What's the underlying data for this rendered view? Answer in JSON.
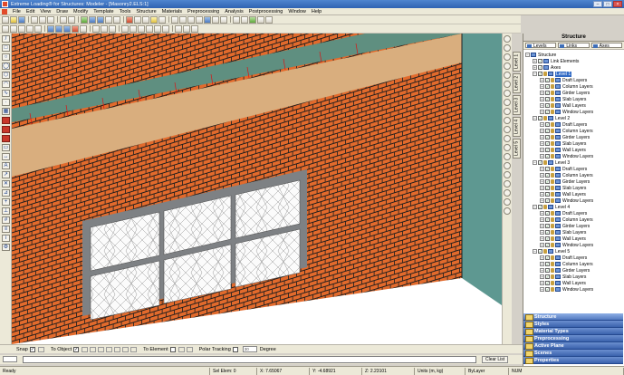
{
  "window": {
    "title": "Extreme Loading® for Structures: Modeler - [Masonry2.ELS:1]"
  },
  "menu": [
    "File",
    "Edit",
    "View",
    "Draw",
    "Modify",
    "Template",
    "Tools",
    "Structure",
    "Materials",
    "Preprocessing",
    "Analysis",
    "Postprocessing",
    "Window",
    "Help"
  ],
  "right_tabs": [
    "Level 1",
    "Level 2",
    "Level 3",
    "Level 4",
    "Level 5"
  ],
  "panel": {
    "title": "Structure",
    "tabs": [
      "Levels",
      "Links",
      "Axes"
    ],
    "tree": [
      {
        "label": "Structure",
        "depth": 0,
        "expand": "−",
        "checked": false,
        "lock": false,
        "selected": false
      },
      {
        "label": "Link Elements",
        "depth": 1,
        "expand": "+",
        "checked": true,
        "lock": false,
        "selected": false
      },
      {
        "label": "Axes",
        "depth": 1,
        "expand": "+",
        "checked": true,
        "lock": false,
        "selected": false
      },
      {
        "label": "Level 1",
        "depth": 1,
        "expand": "−",
        "checked": true,
        "lock": true,
        "selected": true
      },
      {
        "label": "Draft Layers",
        "depth": 2,
        "expand": "+",
        "checked": true,
        "lock": true,
        "selected": false
      },
      {
        "label": "Column Layers",
        "depth": 2,
        "expand": "+",
        "checked": true,
        "lock": true,
        "selected": false
      },
      {
        "label": "Girder Layers",
        "depth": 2,
        "expand": "+",
        "checked": true,
        "lock": true,
        "selected": false
      },
      {
        "label": "Slab Layers",
        "depth": 2,
        "expand": "+",
        "checked": true,
        "lock": true,
        "selected": false
      },
      {
        "label": "Wall Layers",
        "depth": 2,
        "expand": "+",
        "checked": true,
        "lock": true,
        "selected": false
      },
      {
        "label": "Window Layers",
        "depth": 2,
        "expand": "+",
        "checked": true,
        "lock": true,
        "selected": false
      },
      {
        "label": "Level 2",
        "depth": 1,
        "expand": "−",
        "checked": true,
        "lock": true,
        "selected": false
      },
      {
        "label": "Draft Layers",
        "depth": 2,
        "expand": "+",
        "checked": true,
        "lock": true,
        "selected": false
      },
      {
        "label": "Column Layers",
        "depth": 2,
        "expand": "+",
        "checked": true,
        "lock": true,
        "selected": false
      },
      {
        "label": "Girder Layers",
        "depth": 2,
        "expand": "+",
        "checked": true,
        "lock": true,
        "selected": false
      },
      {
        "label": "Slab Layers",
        "depth": 2,
        "expand": "+",
        "checked": true,
        "lock": true,
        "selected": false
      },
      {
        "label": "Wall Layers",
        "depth": 2,
        "expand": "+",
        "checked": true,
        "lock": true,
        "selected": false
      },
      {
        "label": "Window Layers",
        "depth": 2,
        "expand": "+",
        "checked": true,
        "lock": true,
        "selected": false
      },
      {
        "label": "Level 3",
        "depth": 1,
        "expand": "−",
        "checked": true,
        "lock": true,
        "selected": false
      },
      {
        "label": "Draft Layers",
        "depth": 2,
        "expand": "+",
        "checked": true,
        "lock": true,
        "selected": false
      },
      {
        "label": "Column Layers",
        "depth": 2,
        "expand": "+",
        "checked": true,
        "lock": true,
        "selected": false
      },
      {
        "label": "Girder Layers",
        "depth": 2,
        "expand": "+",
        "checked": true,
        "lock": true,
        "selected": false
      },
      {
        "label": "Slab Layers",
        "depth": 2,
        "expand": "+",
        "checked": true,
        "lock": true,
        "selected": false
      },
      {
        "label": "Wall Layers",
        "depth": 2,
        "expand": "+",
        "checked": true,
        "lock": true,
        "selected": false
      },
      {
        "label": "Window Layers",
        "depth": 2,
        "expand": "+",
        "checked": true,
        "lock": true,
        "selected": false
      },
      {
        "label": "Level 4",
        "depth": 1,
        "expand": "−",
        "checked": true,
        "lock": true,
        "selected": false
      },
      {
        "label": "Draft Layers",
        "depth": 2,
        "expand": "+",
        "checked": true,
        "lock": true,
        "selected": false
      },
      {
        "label": "Column Layers",
        "depth": 2,
        "expand": "+",
        "checked": true,
        "lock": true,
        "selected": false
      },
      {
        "label": "Girder Layers",
        "depth": 2,
        "expand": "+",
        "checked": true,
        "lock": true,
        "selected": false
      },
      {
        "label": "Slab Layers",
        "depth": 2,
        "expand": "+",
        "checked": true,
        "lock": true,
        "selected": false
      },
      {
        "label": "Wall Layers",
        "depth": 2,
        "expand": "+",
        "checked": true,
        "lock": true,
        "selected": false
      },
      {
        "label": "Window Layers",
        "depth": 2,
        "expand": "+",
        "checked": true,
        "lock": true,
        "selected": false
      },
      {
        "label": "Level 5",
        "depth": 1,
        "expand": "−",
        "checked": true,
        "lock": true,
        "selected": false
      },
      {
        "label": "Draft Layers",
        "depth": 2,
        "expand": "+",
        "checked": true,
        "lock": true,
        "selected": false
      },
      {
        "label": "Column Layers",
        "depth": 2,
        "expand": "+",
        "checked": true,
        "lock": true,
        "selected": false
      },
      {
        "label": "Girder Layers",
        "depth": 2,
        "expand": "+",
        "checked": true,
        "lock": true,
        "selected": false
      },
      {
        "label": "Slab Layers",
        "depth": 2,
        "expand": "+",
        "checked": true,
        "lock": true,
        "selected": false
      },
      {
        "label": "Wall Layers",
        "depth": 2,
        "expand": "+",
        "checked": true,
        "lock": true,
        "selected": false
      },
      {
        "label": "Window Layers",
        "depth": 2,
        "expand": "+",
        "checked": true,
        "lock": true,
        "selected": false
      }
    ]
  },
  "accordion": [
    "Structure",
    "Styles",
    "Material Types",
    "Preprocessing",
    "Active Plane",
    "Scenes",
    "Properties"
  ],
  "snapbar": {
    "snap_label": "Snap",
    "snap_checked": "✓",
    "to_object": "To Object",
    "to_object_checked": "✓",
    "to_element": "To Element",
    "polar_tracking": "Polar Tracking",
    "degree_value": "30",
    "degree_label": "Degree"
  },
  "cmdbar": {
    "clear_label": "Clear List"
  },
  "status": {
    "ready": "Ready",
    "sel_elem": "Sel Elem: 0",
    "x": "X: 7.65067",
    "y": "Y: -4.68921",
    "z": "Z: 2.23101",
    "units": "Units (m, kg)",
    "bylayer": "ByLayer",
    "num": "NUM"
  },
  "scene_colors": {
    "brick": "#e26a2c",
    "mortar": "#1d1d1d",
    "parapet": "#d9ae7e",
    "coping": "#5f8f80",
    "side_wall": "#5e9891",
    "window_frame": "#7e8184"
  }
}
